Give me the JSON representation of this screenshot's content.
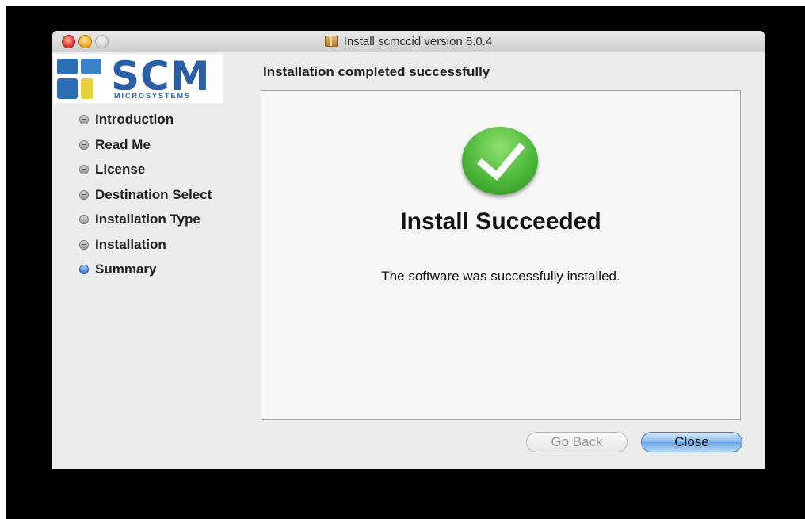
{
  "window": {
    "title": "Install scmccid version 5.0.4"
  },
  "logo": {
    "name": "SCM",
    "subtitle": "MICROSYSTEMS"
  },
  "steps": [
    {
      "label": "Introduction",
      "active": false
    },
    {
      "label": "Read Me",
      "active": false
    },
    {
      "label": "License",
      "active": false
    },
    {
      "label": "Destination Select",
      "active": false
    },
    {
      "label": "Installation Type",
      "active": false
    },
    {
      "label": "Installation",
      "active": false
    },
    {
      "label": "Summary",
      "active": true
    }
  ],
  "content": {
    "heading": "Installation completed successfully",
    "result_title": "Install Succeeded",
    "result_message": "The software was successfully installed."
  },
  "buttons": {
    "back_label": "Go Back",
    "close_label": "Close"
  },
  "colors": {
    "accent": "#3a78cc",
    "success": "#4db83a"
  }
}
